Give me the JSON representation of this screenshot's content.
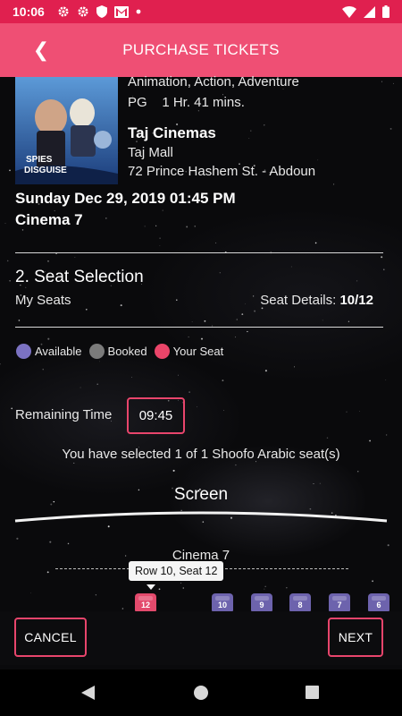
{
  "status_bar": {
    "time": "10:06",
    "notification_icons": [
      "gear-icon",
      "gear-icon",
      "shield-icon",
      "gmail-icon",
      "dot-icon"
    ],
    "right_icons": [
      "wifi-icon",
      "cellular-icon",
      "battery-icon"
    ]
  },
  "app_bar": {
    "back_icon": "chevron-left-icon",
    "back_glyph": "❮",
    "title": "PURCHASE TICKETS"
  },
  "movie": {
    "poster_alt": "SPIES IN DISGUISE",
    "genre": "Animation, Action, Adventure",
    "rating_runtime": "PG    1 Hr. 41 mins.",
    "cinema": "Taj Cinemas",
    "mall": "Taj Mall",
    "address": "72 Prince Hashem St. - Abdoun",
    "showtime": "Sunday Dec 29, 2019 01:45 PM",
    "hall": "Cinema 7"
  },
  "seat_selection": {
    "title": "2. Seat Selection",
    "my_seats_label": "My Seats",
    "seat_details_label": "Seat Details:",
    "seat_details_value": "10/12"
  },
  "legend": [
    {
      "label": "Available",
      "color": "#7b72c2"
    },
    {
      "label": "Booked",
      "color": "#7b7b7b"
    },
    {
      "label": "Your Seat",
      "color": "#ea4569"
    }
  ],
  "timer": {
    "label": "Remaining Time",
    "value": "09:45"
  },
  "selection_message": "You have selected 1 of 1 Shoofo Arabic seat(s)",
  "screen_label": "Screen",
  "seat_map": {
    "hall_label": "Cinema 7",
    "tooltip": "Row 10, Seat 12",
    "seats": [
      {
        "number": "12",
        "status": "selected"
      },
      {
        "number": "10",
        "status": "available"
      },
      {
        "number": "9",
        "status": "available"
      },
      {
        "number": "8",
        "status": "available"
      },
      {
        "number": "7",
        "status": "available"
      },
      {
        "number": "6",
        "status": "available"
      }
    ],
    "colors": {
      "available": "#6d63ad",
      "selected": "#e34a6c"
    }
  },
  "actions": {
    "cancel": "CANCEL",
    "next": "NEXT"
  },
  "nav_bar": {
    "icons": [
      "back-triangle-icon",
      "home-circle-icon",
      "recents-square-icon"
    ]
  }
}
